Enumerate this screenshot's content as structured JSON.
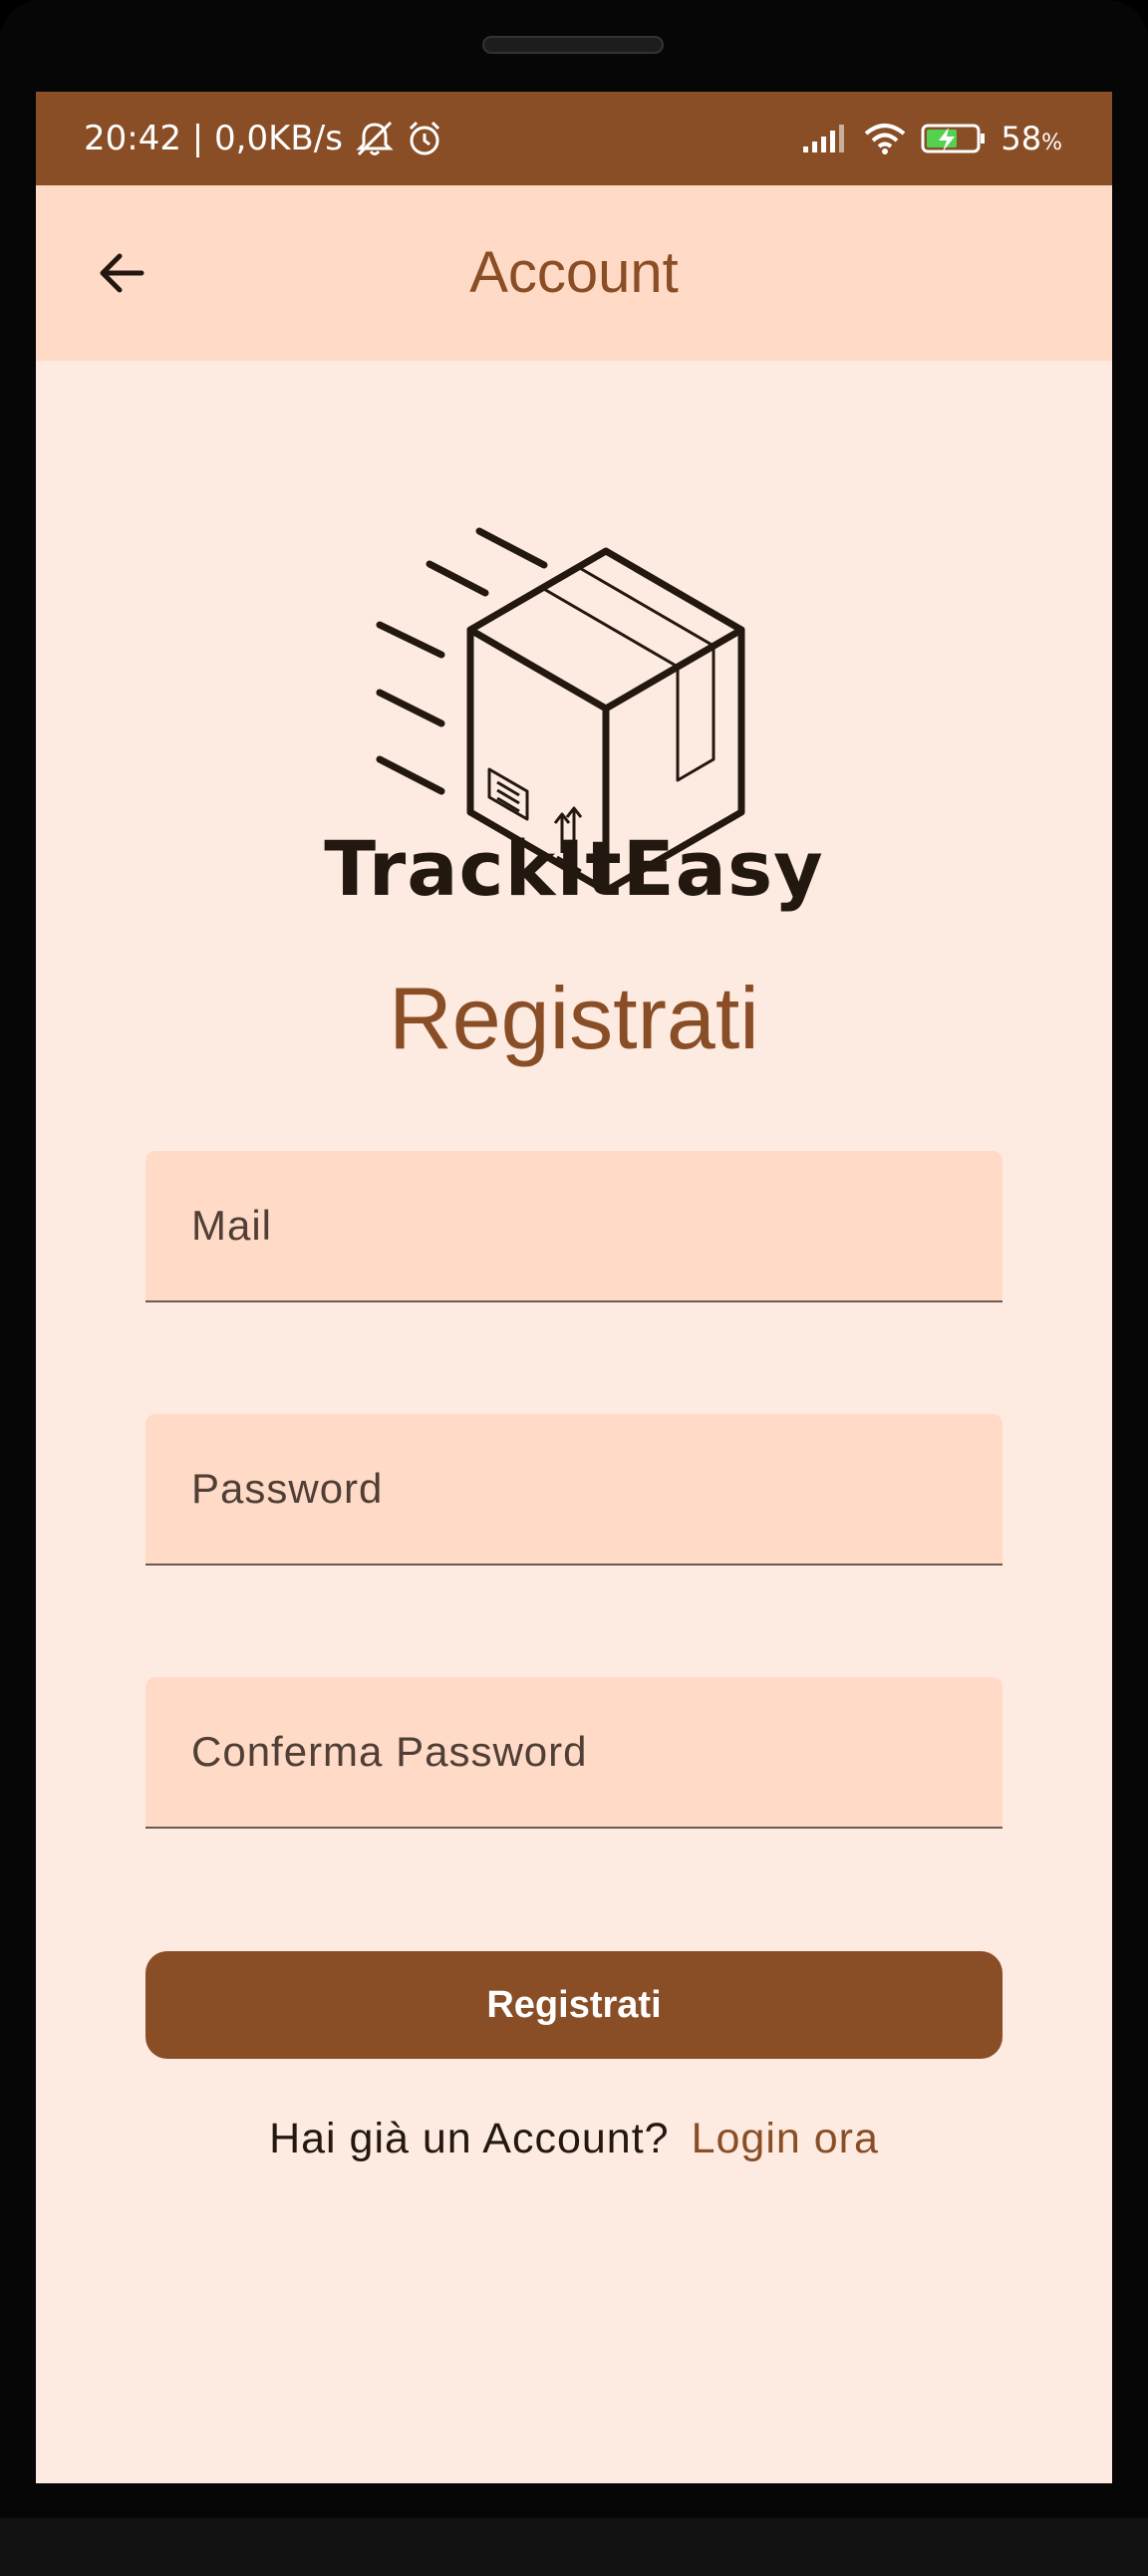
{
  "status_bar": {
    "time_and_speed": "20:42 | 0,0KB/s",
    "battery_percent": "58",
    "battery_unit": "%",
    "icons": [
      "mute-bell-icon",
      "alarm-icon",
      "signal-icon",
      "wifi-icon",
      "battery-charging-icon"
    ]
  },
  "app_bar": {
    "title": "Account",
    "back_icon": "arrow-left-icon"
  },
  "logo": {
    "icon": "moving-box-icon",
    "wordmark": "TrackItEasy"
  },
  "form": {
    "heading": "Registrati",
    "mail_placeholder": "Mail",
    "password_placeholder": "Password",
    "confirm_placeholder": "Conferma Password",
    "submit_label": "Registrati"
  },
  "footer": {
    "question": "Hai già un Account?",
    "link": "Login ora"
  },
  "colors": {
    "brand": "#8a4e27",
    "surface": "#fdebe1",
    "field_fill": "#ffdac7",
    "text_dark": "#231810"
  }
}
